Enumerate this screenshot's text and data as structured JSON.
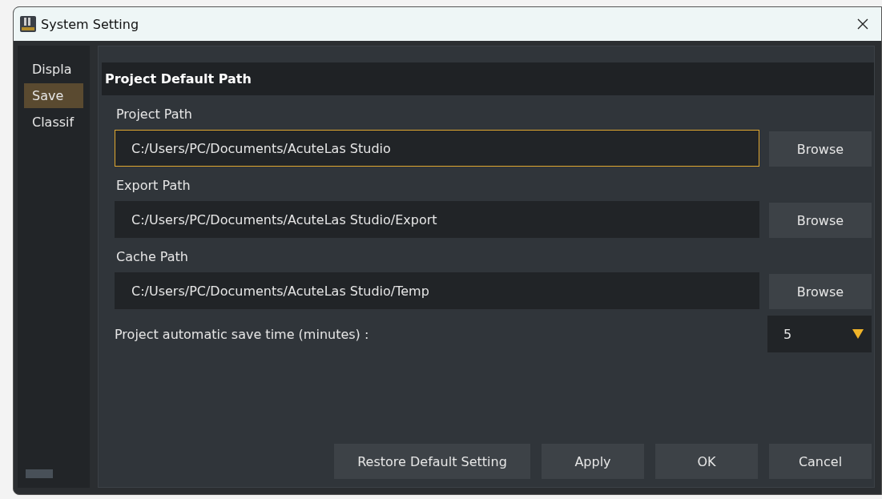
{
  "window": {
    "title": "System Setting"
  },
  "sidebar": {
    "items": [
      {
        "label": "Displa",
        "selected": false
      },
      {
        "label": "Save",
        "selected": true
      },
      {
        "label": "Classif",
        "selected": false
      }
    ]
  },
  "section": {
    "title": "Project Default Path"
  },
  "paths": [
    {
      "label": "Project Path",
      "value": "C:/Users/PC/Documents/AcuteLas Studio",
      "focused": true,
      "button": "Browse"
    },
    {
      "label": "Export Path",
      "value": "C:/Users/PC/Documents/AcuteLas Studio/Export",
      "focused": false,
      "button": "Browse"
    },
    {
      "label": "Cache Path",
      "value": "C:/Users/PC/Documents/AcuteLas Studio/Temp",
      "focused": false,
      "button": "Browse"
    }
  ],
  "autosave": {
    "label": "Project automatic save time (minutes) :",
    "value": "5"
  },
  "buttons": [
    "Restore Default Setting",
    "Apply",
    "OK",
    "Cancel"
  ]
}
